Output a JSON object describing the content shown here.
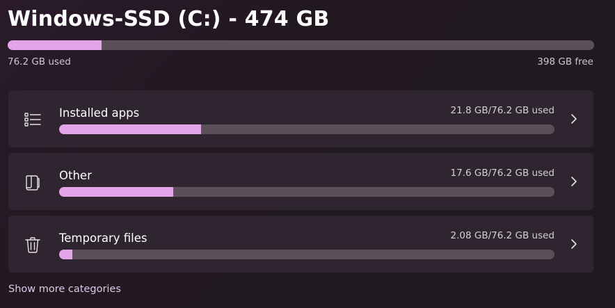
{
  "drive": {
    "title": "Windows-SSD (C:) - 474 GB",
    "used_label": "76.2 GB used",
    "free_label": "398 GB free",
    "used_fraction": 0.16
  },
  "categories": [
    {
      "name": "Installed apps",
      "amount": "21.8 GB/76.2 GB used",
      "fraction": 0.286,
      "icon": "list-icon"
    },
    {
      "name": "Other",
      "amount": "17.6 GB/76.2 GB used",
      "fraction": 0.231,
      "icon": "document-icon"
    },
    {
      "name": "Temporary files",
      "amount": "2.08 GB/76.2 GB used",
      "fraction": 0.027,
      "icon": "trash-icon"
    }
  ],
  "more_label": "Show more categories",
  "colors": {
    "accent": "#e3a4ea",
    "track": "#5b4f58",
    "card": "#2f2530"
  }
}
